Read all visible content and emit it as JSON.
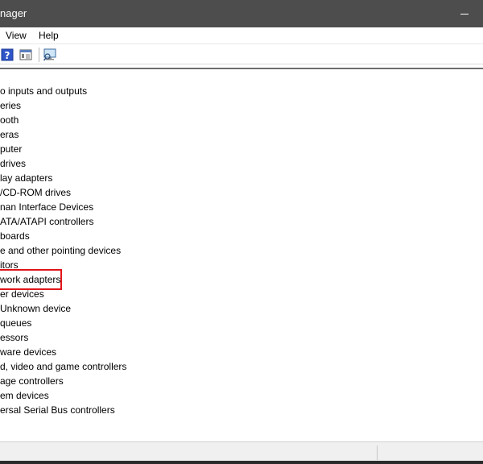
{
  "window": {
    "title": "nager"
  },
  "menu": {
    "view": "View",
    "help": "Help"
  },
  "toolbar": {
    "icons": [
      "help-icon",
      "properties-icon",
      "scan-hardware-icon"
    ]
  },
  "tree": {
    "items": [
      "o inputs and outputs",
      "eries",
      "ooth",
      "eras",
      "puter",
      "drives",
      "lay adapters",
      "/CD-ROM drives",
      "nan Interface Devices",
      "ATA/ATAPI controllers",
      "boards",
      "e and other pointing devices",
      "itors",
      "work adapters",
      "er devices",
      "Unknown device",
      " queues",
      "essors",
      "ware devices",
      "d, video and game controllers",
      "age controllers",
      "em devices",
      "ersal Serial Bus controllers"
    ],
    "highlighted_index": 13
  },
  "colors": {
    "titlebar": "#4d4d4d",
    "highlight": "#e0161b"
  }
}
